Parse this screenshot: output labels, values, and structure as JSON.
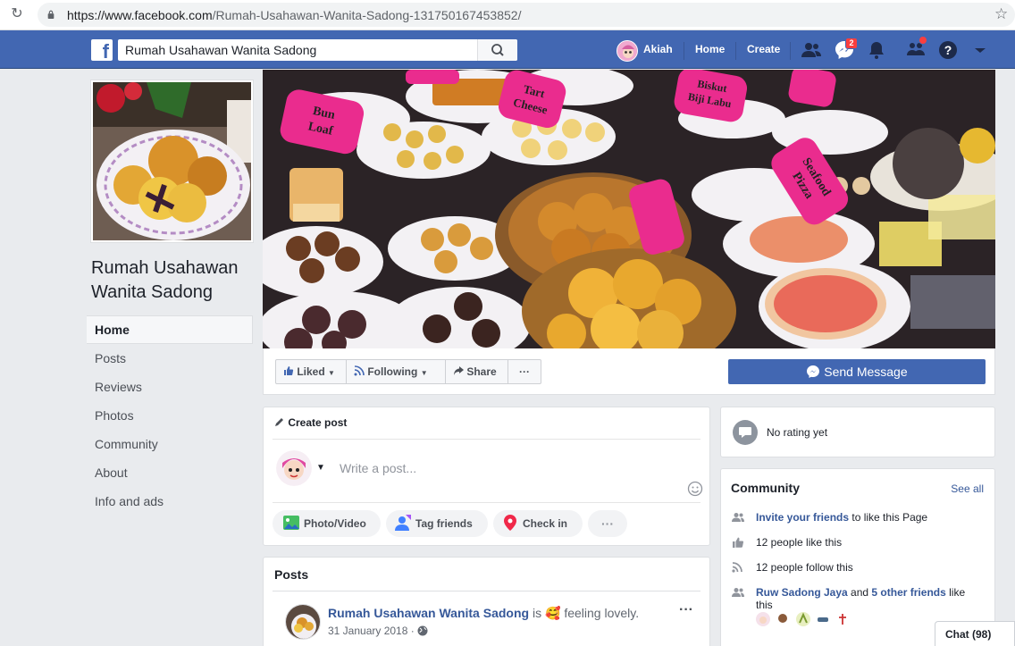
{
  "browser": {
    "url_base": "https://www.facebook.com",
    "url_path": "/Rumah-Usahawan-Wanita-Sadong-131750167453852/"
  },
  "fbbar": {
    "search_value": "Rumah Usahawan Wanita Sadong",
    "user_name": "Akiah",
    "home_label": "Home",
    "create_label": "Create",
    "messages_count": "2"
  },
  "page": {
    "name_line1": "Rumah Usahawan",
    "name_line2": "Wanita Sadong"
  },
  "left_nav": [
    {
      "label": "Home"
    },
    {
      "label": "Posts"
    },
    {
      "label": "Reviews"
    },
    {
      "label": "Photos"
    },
    {
      "label": "Community"
    },
    {
      "label": "About"
    },
    {
      "label": "Info and ads"
    }
  ],
  "cover_labels": {
    "bun_loaf": "Bun Loaf",
    "tart_cheese": "Tart Cheese",
    "biskut": "Biskut Biji Labu",
    "seafood": "Seafood Pizza"
  },
  "actions": {
    "liked": "Liked",
    "following": "Following",
    "share": "Share",
    "more": "···",
    "send_message": "Send Message"
  },
  "composer": {
    "title": "Create post",
    "placeholder": "Write a post...",
    "photo_video": "Photo/Video",
    "tag_friends": "Tag friends",
    "check_in": "Check in",
    "more": "···"
  },
  "posts": {
    "heading": "Posts",
    "author": "Rumah Usahawan Wanita Sadong",
    "is": "is",
    "feeling": "feeling lovely.",
    "date": "31 January 2018",
    "more": "···"
  },
  "rating": {
    "text": "No rating yet"
  },
  "community": {
    "heading": "Community",
    "see_all": "See all",
    "invite_link": "Invite your friends",
    "invite_rest": "to like this Page",
    "likes": "12 people like this",
    "follows": "12 people follow this",
    "friend_name": "Ruw Sadong Jaya",
    "and": "and",
    "others": "5 other friends",
    "like_this_1": "like",
    "like_this_2": "this"
  },
  "chat": {
    "label": "Chat (98)"
  },
  "colors": {
    "fb_blue": "#4267b2",
    "link": "#365899",
    "background": "#e9ebee"
  }
}
